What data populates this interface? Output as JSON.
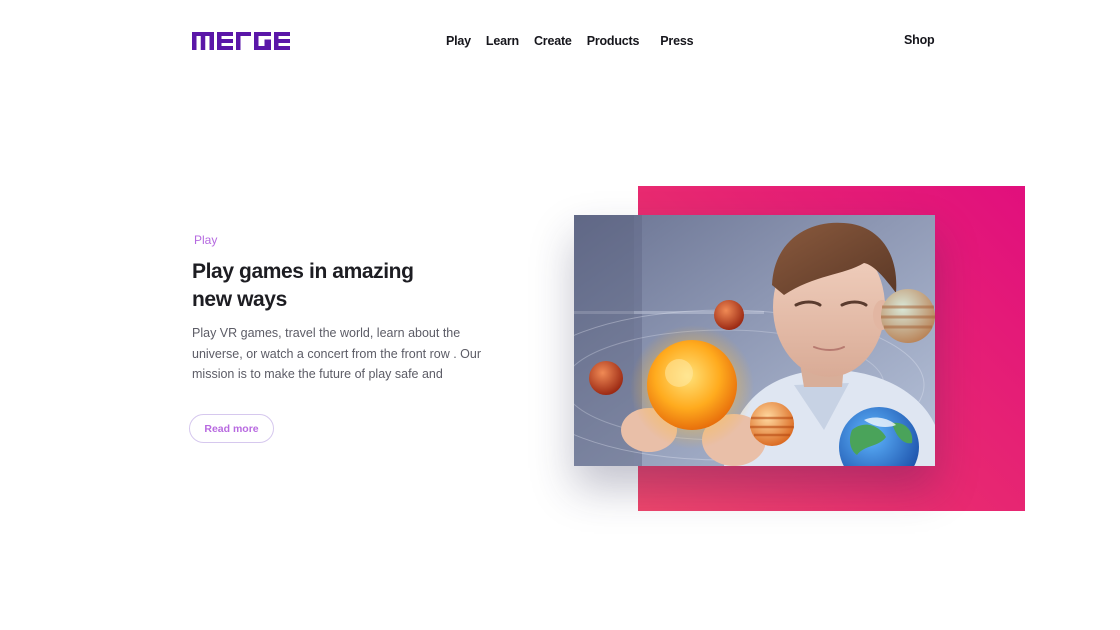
{
  "header": {
    "logo_text": "MERGE",
    "nav": [
      {
        "label": "Play"
      },
      {
        "label": "Learn"
      },
      {
        "label": "Create"
      },
      {
        "label": "Products"
      },
      {
        "label": "Press"
      }
    ],
    "shop_label": "Shop"
  },
  "hero": {
    "eyebrow": "Play",
    "headline": "Play games in amazing new ways",
    "body": "Play VR games, travel the world, learn about the universe, or watch a concert from the front row . Our mission is to make the future of play safe and",
    "cta_label": "Read more"
  },
  "colors": {
    "brand": "#5a16a8",
    "accent": "#b86ae0",
    "panel": "#e10f7d"
  }
}
